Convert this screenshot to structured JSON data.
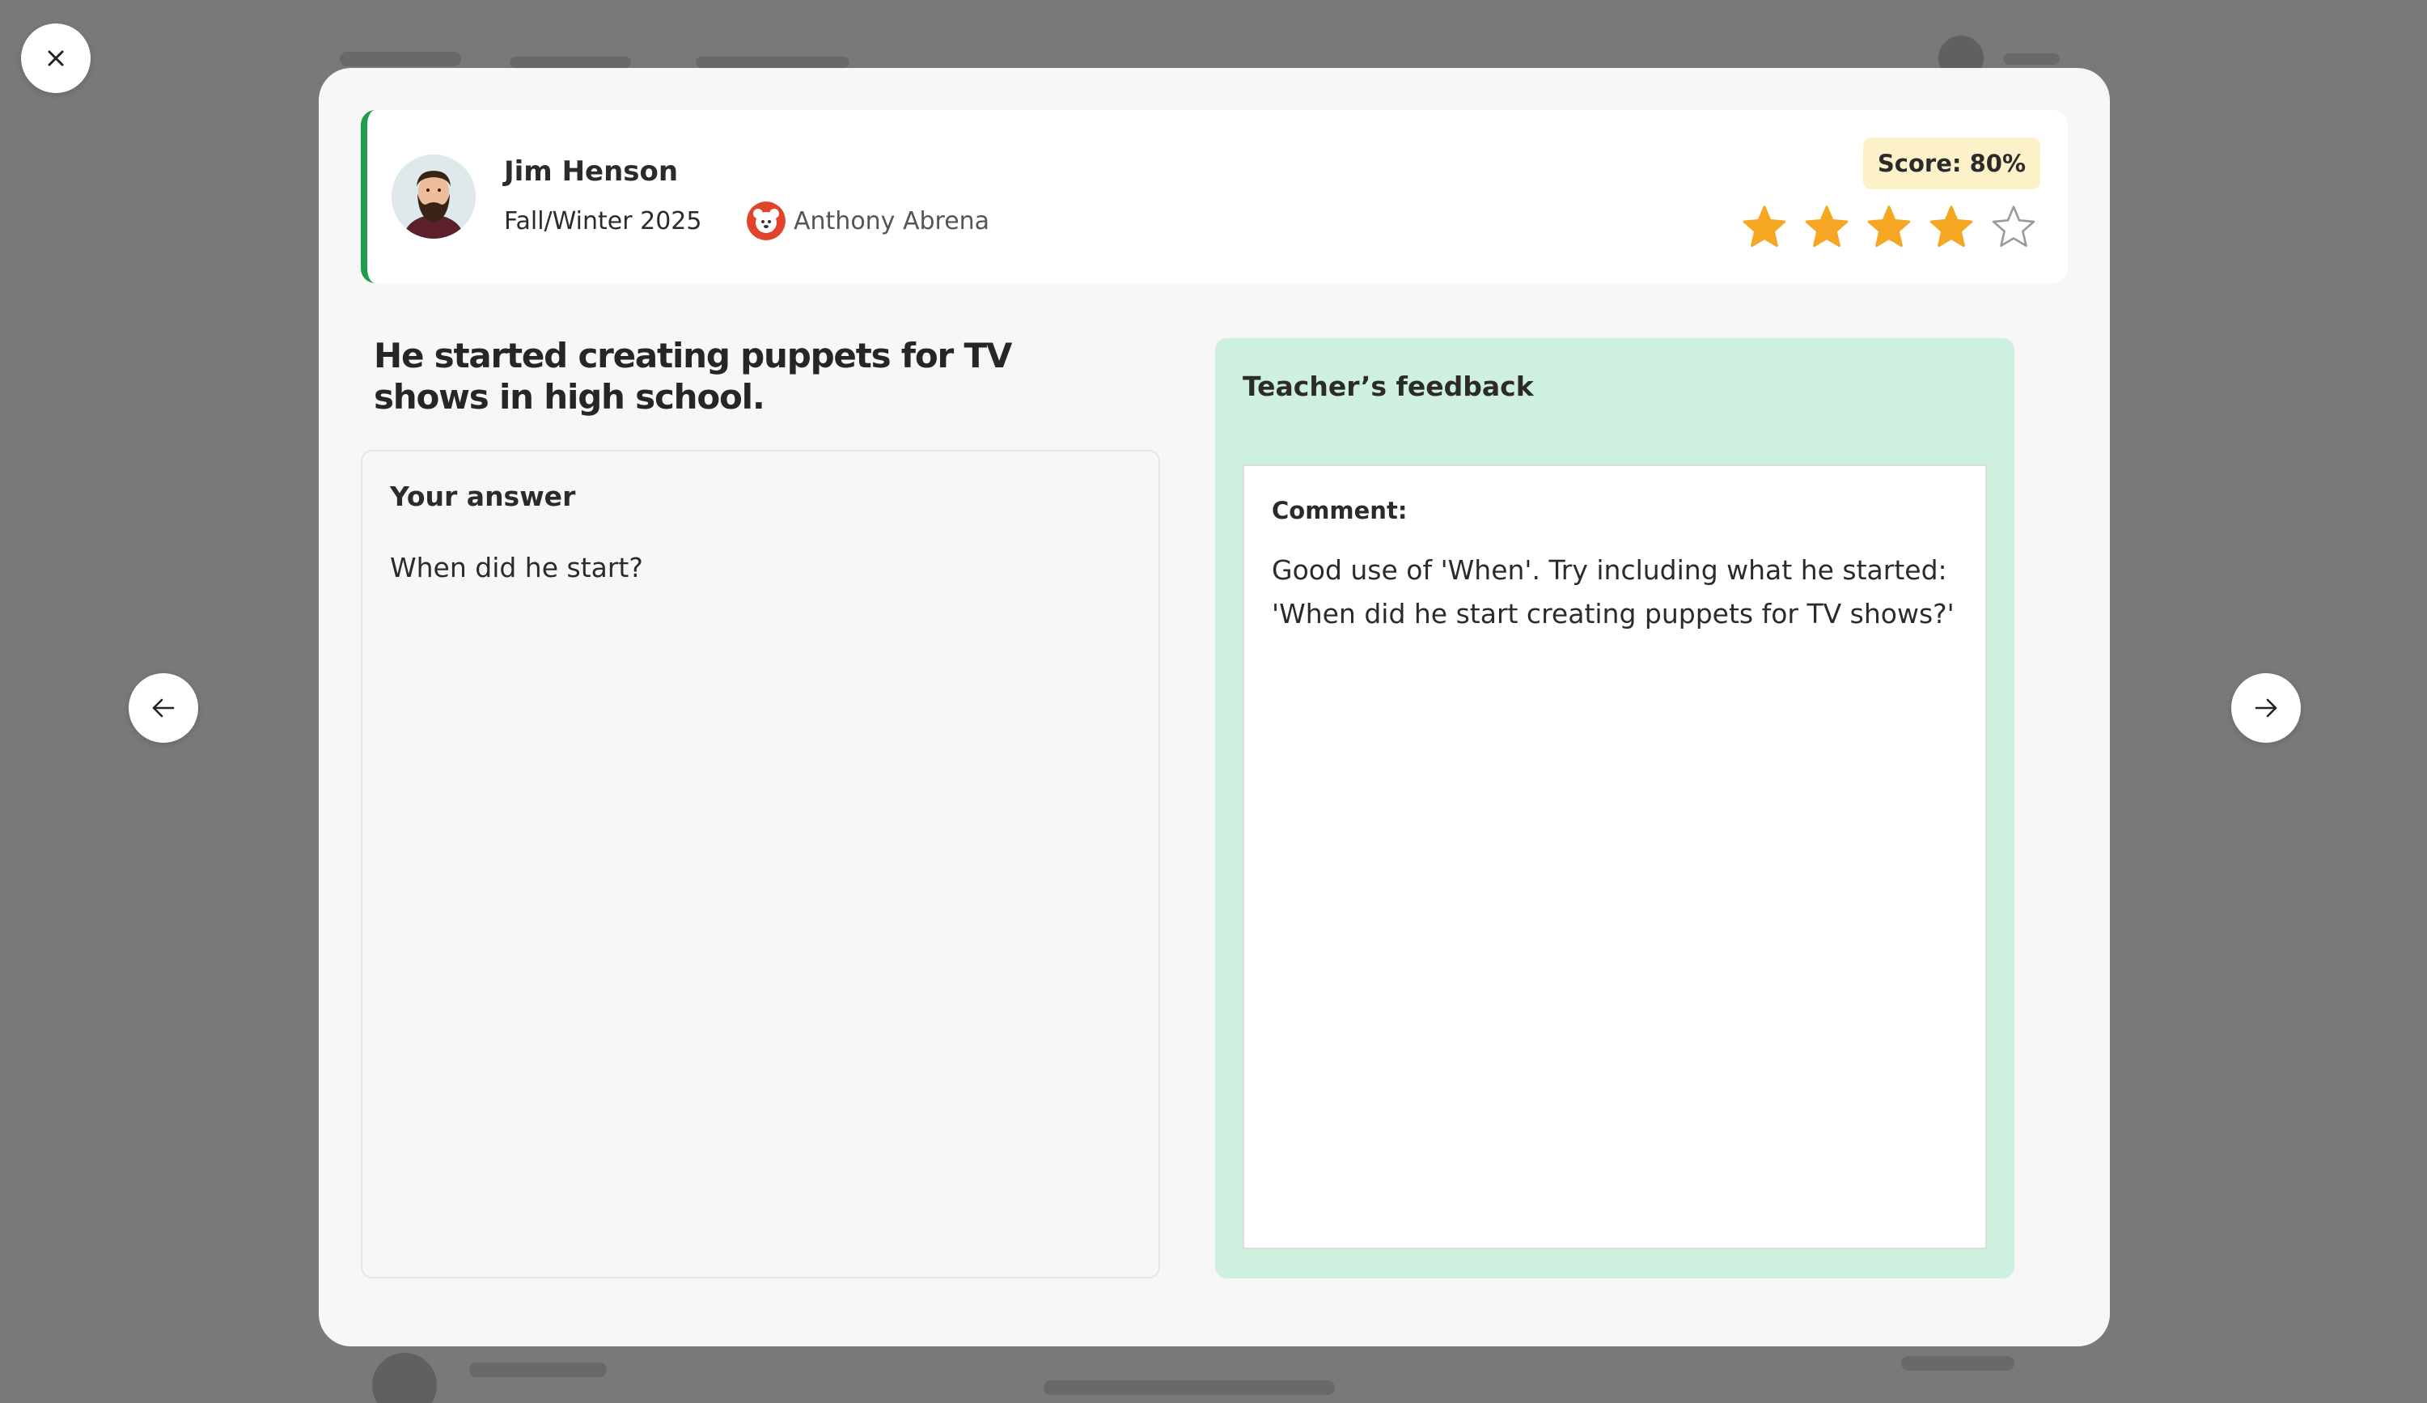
{
  "modal": {
    "student": {
      "name": "Jim Henson",
      "term": "Fall/Winter 2025"
    },
    "teacher": {
      "name": "Anthony Abrena"
    },
    "score": {
      "label": "Score: 80%",
      "stars_filled": 4,
      "stars_total": 5
    },
    "prompt": "He started creating puppets for TV shows in high school.",
    "answer": {
      "label": "Your answer",
      "text": "When did he start?"
    },
    "feedback": {
      "title": "Teacher’s feedback",
      "comment_label": "Comment:",
      "comment_text": "Good use of 'When'. Try including what he started: 'When did he start creating puppets for TV shows?'"
    }
  },
  "icons": {
    "close": "close-icon",
    "prev": "arrow-left-icon",
    "next": "arrow-right-icon",
    "star": "star-icon"
  },
  "colors": {
    "accent_green": "#1f9d48",
    "star_filled": "#f5a623",
    "star_empty_stroke": "#9a9a9a",
    "score_badge_bg": "#fdf1c9",
    "feedback_bg": "#cdf0df",
    "teacher_avatar_red": "#e0452b"
  }
}
